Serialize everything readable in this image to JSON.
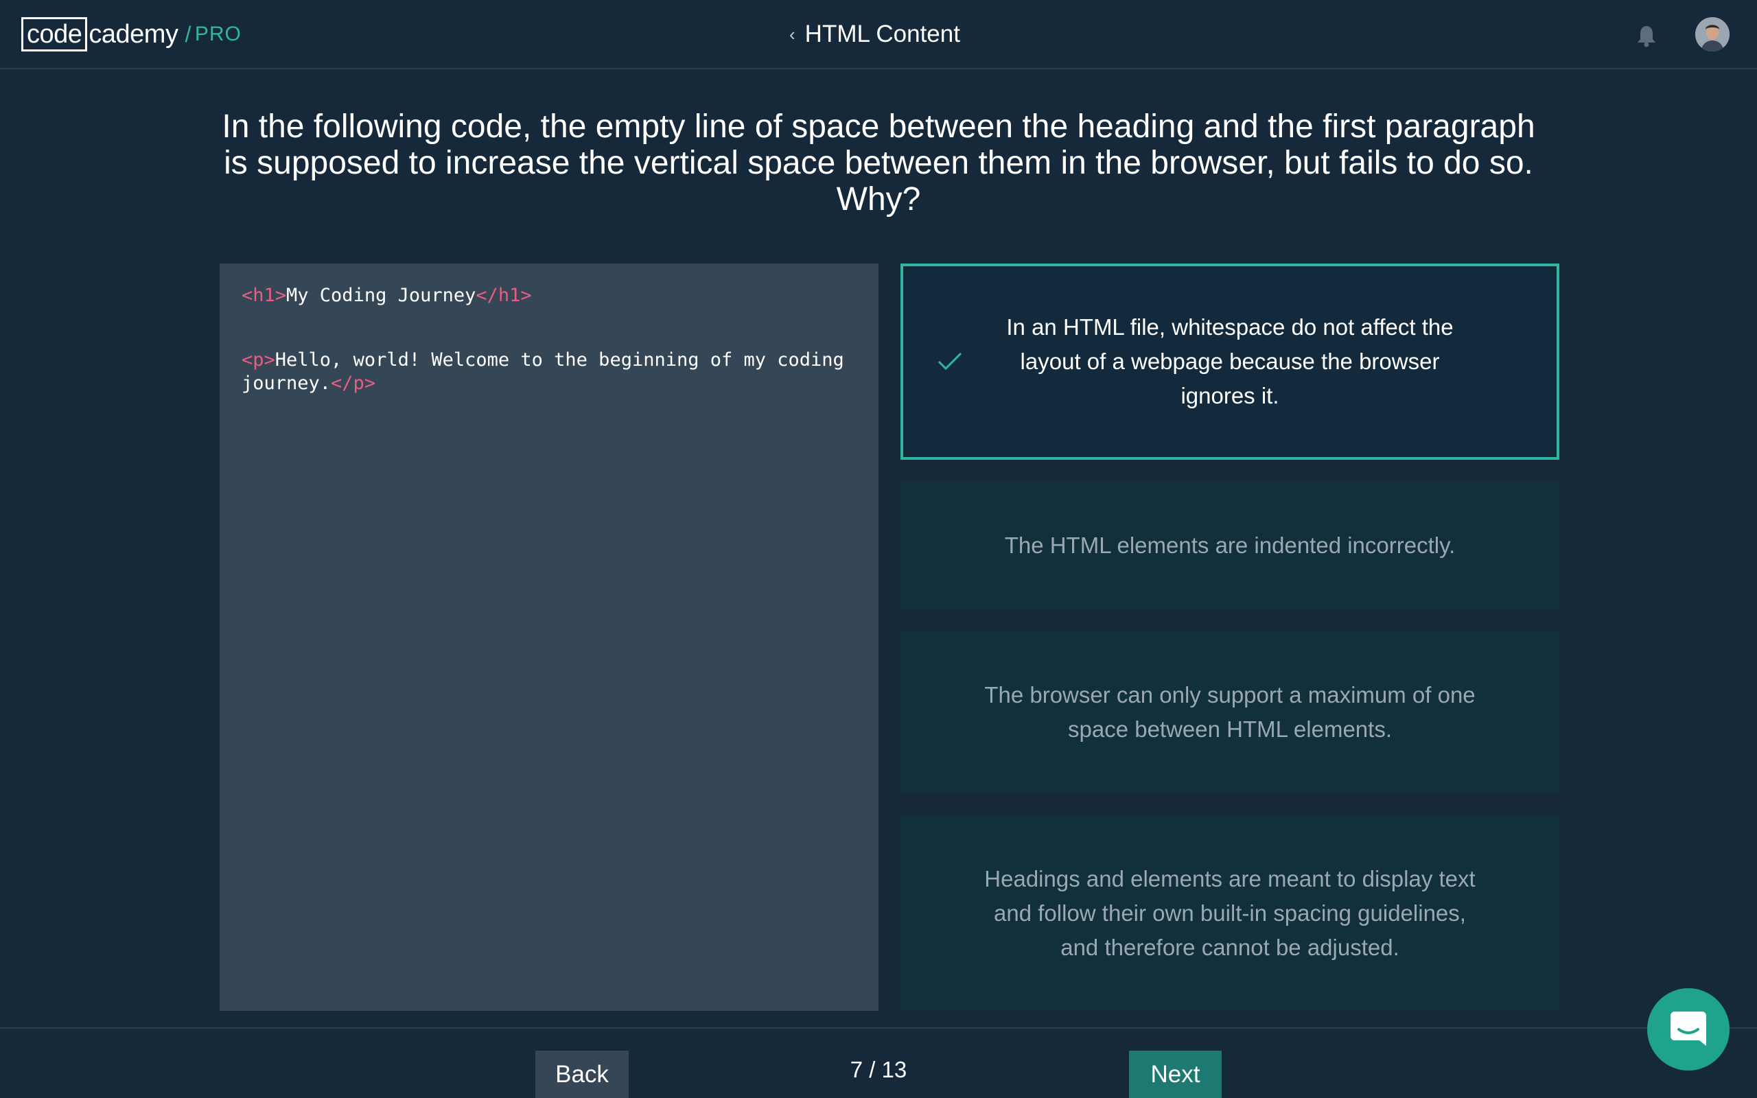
{
  "header": {
    "logo_code": "code",
    "logo_cademy": "cademy",
    "logo_slash": "/",
    "logo_pro": "PRO",
    "breadcrumb_chevron": "‹",
    "breadcrumb_title": "HTML Content",
    "icons": [
      "bell-icon",
      "avatar"
    ]
  },
  "question": {
    "text": "In the following code, the empty line of space between the heading and the first paragraph is supposed to increase the vertical space between them in the browser, but fails to do so. Why?"
  },
  "code": {
    "line1_open": "<h1>",
    "line1_text": "My Coding Journey",
    "line1_close": "</h1>",
    "line3_open": "<p>",
    "line3_text": "Hello, world! Welcome to the beginning of my coding journey.",
    "line3_close": "</p>"
  },
  "answers": [
    {
      "text": "In an HTML file, whitespace do not affect the layout of a webpage because the browser ignores it.",
      "selected": true
    },
    {
      "text": "The HTML elements are indented incorrectly.",
      "selected": false
    },
    {
      "text": "The browser can only support a maximum of one space between HTML elements.",
      "selected": false
    },
    {
      "text": "Headings and elements are meant to display text and follow their own built-in spacing guidelines, and therefore cannot be adjusted.",
      "selected": false
    }
  ],
  "footer": {
    "back_label": "Back",
    "progress": "7 / 13",
    "next_label": "Next"
  },
  "colors": {
    "background": "#15293a",
    "accent": "#2fb8a0",
    "tag": "#e85d81",
    "code_bg": "#354656",
    "answer_bg": "#122f3c"
  }
}
